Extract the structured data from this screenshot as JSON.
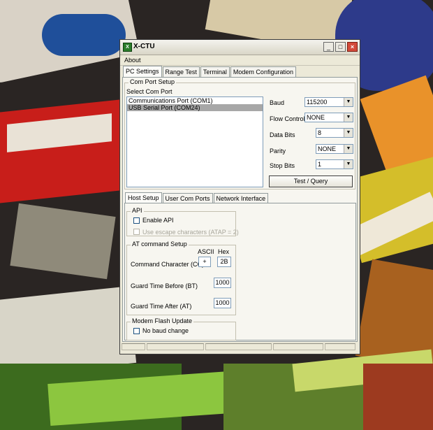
{
  "window": {
    "title": "X-CTU",
    "menu": [
      "About"
    ],
    "tabs": [
      "PC Settings",
      "Range Test",
      "Terminal",
      "Modem Configuration"
    ]
  },
  "com_port_setup": {
    "group_label": "Com Port Setup",
    "select_label": "Select Com Port",
    "ports": [
      "Communications Port (COM1)",
      "USB Serial Port (COM24)"
    ],
    "selected_port": "USB Serial Port (COM24)"
  },
  "settings": {
    "baud_label": "Baud",
    "baud_value": "115200",
    "flow_label": "Flow Control",
    "flow_value": "NONE",
    "databits_label": "Data Bits",
    "databits_value": "8",
    "parity_label": "Parity",
    "parity_value": "NONE",
    "stopbits_label": "Stop Bits",
    "stopbits_value": "1",
    "test_button": "Test / Query"
  },
  "subtabs": [
    "Host Setup",
    "User Com Ports",
    "Network Interface"
  ],
  "api": {
    "group_label": "API",
    "enable_label": "Enable API",
    "enable_checked": false,
    "escape_label": "Use escape characters (ATAP = 2)",
    "escape_checked": false
  },
  "at_command": {
    "group_label": "AT command Setup",
    "ascii_header": "ASCII",
    "hex_header": "Hex",
    "cc_label": "Command Character (CC)",
    "cc_ascii": "+",
    "cc_hex": "2B",
    "bt_label": "Guard Time Before (BT)",
    "bt_value": "1000",
    "at_label": "Guard Time After (AT)",
    "at_value": "1000"
  },
  "flash_update": {
    "group_label": "Modem Flash Update",
    "no_baud_label": "No baud change",
    "no_baud_checked": false
  },
  "icons": {
    "app": "xctu-app-icon",
    "minimize": "minimize-icon",
    "maximize": "maximize-icon",
    "close": "close-icon",
    "dropdown": "chevron-down-icon"
  }
}
